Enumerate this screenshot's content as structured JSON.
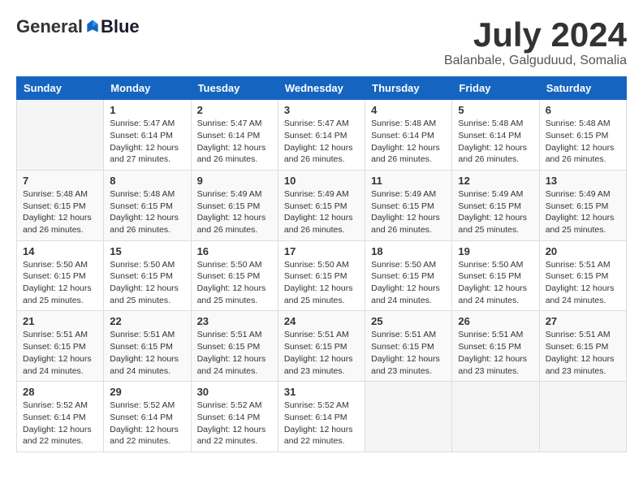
{
  "header": {
    "logo_general": "General",
    "logo_blue": "Blue",
    "month_title": "July 2024",
    "location": "Balanbale, Galguduud, Somalia"
  },
  "days_of_week": [
    "Sunday",
    "Monday",
    "Tuesday",
    "Wednesday",
    "Thursday",
    "Friday",
    "Saturday"
  ],
  "weeks": [
    [
      {
        "day": "",
        "info": ""
      },
      {
        "day": "1",
        "info": "Sunrise: 5:47 AM\nSunset: 6:14 PM\nDaylight: 12 hours\nand 27 minutes."
      },
      {
        "day": "2",
        "info": "Sunrise: 5:47 AM\nSunset: 6:14 PM\nDaylight: 12 hours\nand 26 minutes."
      },
      {
        "day": "3",
        "info": "Sunrise: 5:47 AM\nSunset: 6:14 PM\nDaylight: 12 hours\nand 26 minutes."
      },
      {
        "day": "4",
        "info": "Sunrise: 5:48 AM\nSunset: 6:14 PM\nDaylight: 12 hours\nand 26 minutes."
      },
      {
        "day": "5",
        "info": "Sunrise: 5:48 AM\nSunset: 6:14 PM\nDaylight: 12 hours\nand 26 minutes."
      },
      {
        "day": "6",
        "info": "Sunrise: 5:48 AM\nSunset: 6:15 PM\nDaylight: 12 hours\nand 26 minutes."
      }
    ],
    [
      {
        "day": "7",
        "info": "Sunrise: 5:48 AM\nSunset: 6:15 PM\nDaylight: 12 hours\nand 26 minutes."
      },
      {
        "day": "8",
        "info": "Sunrise: 5:48 AM\nSunset: 6:15 PM\nDaylight: 12 hours\nand 26 minutes."
      },
      {
        "day": "9",
        "info": "Sunrise: 5:49 AM\nSunset: 6:15 PM\nDaylight: 12 hours\nand 26 minutes."
      },
      {
        "day": "10",
        "info": "Sunrise: 5:49 AM\nSunset: 6:15 PM\nDaylight: 12 hours\nand 26 minutes."
      },
      {
        "day": "11",
        "info": "Sunrise: 5:49 AM\nSunset: 6:15 PM\nDaylight: 12 hours\nand 26 minutes."
      },
      {
        "day": "12",
        "info": "Sunrise: 5:49 AM\nSunset: 6:15 PM\nDaylight: 12 hours\nand 25 minutes."
      },
      {
        "day": "13",
        "info": "Sunrise: 5:49 AM\nSunset: 6:15 PM\nDaylight: 12 hours\nand 25 minutes."
      }
    ],
    [
      {
        "day": "14",
        "info": "Sunrise: 5:50 AM\nSunset: 6:15 PM\nDaylight: 12 hours\nand 25 minutes."
      },
      {
        "day": "15",
        "info": "Sunrise: 5:50 AM\nSunset: 6:15 PM\nDaylight: 12 hours\nand 25 minutes."
      },
      {
        "day": "16",
        "info": "Sunrise: 5:50 AM\nSunset: 6:15 PM\nDaylight: 12 hours\nand 25 minutes."
      },
      {
        "day": "17",
        "info": "Sunrise: 5:50 AM\nSunset: 6:15 PM\nDaylight: 12 hours\nand 25 minutes."
      },
      {
        "day": "18",
        "info": "Sunrise: 5:50 AM\nSunset: 6:15 PM\nDaylight: 12 hours\nand 24 minutes."
      },
      {
        "day": "19",
        "info": "Sunrise: 5:50 AM\nSunset: 6:15 PM\nDaylight: 12 hours\nand 24 minutes."
      },
      {
        "day": "20",
        "info": "Sunrise: 5:51 AM\nSunset: 6:15 PM\nDaylight: 12 hours\nand 24 minutes."
      }
    ],
    [
      {
        "day": "21",
        "info": "Sunrise: 5:51 AM\nSunset: 6:15 PM\nDaylight: 12 hours\nand 24 minutes."
      },
      {
        "day": "22",
        "info": "Sunrise: 5:51 AM\nSunset: 6:15 PM\nDaylight: 12 hours\nand 24 minutes."
      },
      {
        "day": "23",
        "info": "Sunrise: 5:51 AM\nSunset: 6:15 PM\nDaylight: 12 hours\nand 24 minutes."
      },
      {
        "day": "24",
        "info": "Sunrise: 5:51 AM\nSunset: 6:15 PM\nDaylight: 12 hours\nand 23 minutes."
      },
      {
        "day": "25",
        "info": "Sunrise: 5:51 AM\nSunset: 6:15 PM\nDaylight: 12 hours\nand 23 minutes."
      },
      {
        "day": "26",
        "info": "Sunrise: 5:51 AM\nSunset: 6:15 PM\nDaylight: 12 hours\nand 23 minutes."
      },
      {
        "day": "27",
        "info": "Sunrise: 5:51 AM\nSunset: 6:15 PM\nDaylight: 12 hours\nand 23 minutes."
      }
    ],
    [
      {
        "day": "28",
        "info": "Sunrise: 5:52 AM\nSunset: 6:14 PM\nDaylight: 12 hours\nand 22 minutes."
      },
      {
        "day": "29",
        "info": "Sunrise: 5:52 AM\nSunset: 6:14 PM\nDaylight: 12 hours\nand 22 minutes."
      },
      {
        "day": "30",
        "info": "Sunrise: 5:52 AM\nSunset: 6:14 PM\nDaylight: 12 hours\nand 22 minutes."
      },
      {
        "day": "31",
        "info": "Sunrise: 5:52 AM\nSunset: 6:14 PM\nDaylight: 12 hours\nand 22 minutes."
      },
      {
        "day": "",
        "info": ""
      },
      {
        "day": "",
        "info": ""
      },
      {
        "day": "",
        "info": ""
      }
    ]
  ]
}
